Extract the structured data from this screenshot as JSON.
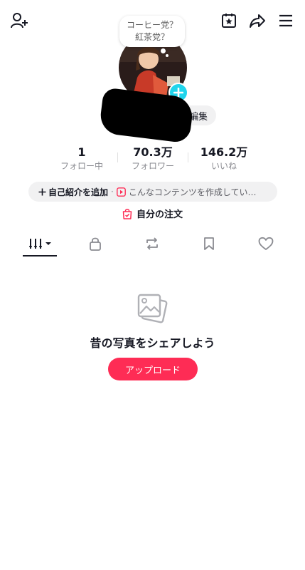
{
  "header": {
    "add_friend_icon": "person-plus-icon",
    "calendar_icon": "calendar-star-icon",
    "share_icon": "share-arrow-icon",
    "menu_icon": "hamburger-menu-icon"
  },
  "profile": {
    "bubble_line1": "コーヒー党？",
    "bubble_line2": "紅茶党？",
    "edit_label": "編集"
  },
  "stats": [
    {
      "value": "1",
      "label": "フォロー中"
    },
    {
      "value": "70.3万",
      "label": "フォロワー"
    },
    {
      "value": "146.2万",
      "label": "いいね"
    }
  ],
  "bio": {
    "add_label": "自己紹介を追加",
    "separator": "·",
    "link_label": "こんなコンテンツを作成してい…"
  },
  "orders": {
    "label": "自分の注文"
  },
  "tabs": [
    "videos-tab",
    "private-tab",
    "repost-tab",
    "favorites-tab",
    "liked-tab"
  ],
  "empty_state": {
    "title": "昔の写真をシェアしよう",
    "button_label": "アップロード"
  },
  "colors": {
    "accent": "#fe2c55",
    "badge": "#20d5ec",
    "text": "#161823",
    "muted": "#8a8b91"
  }
}
